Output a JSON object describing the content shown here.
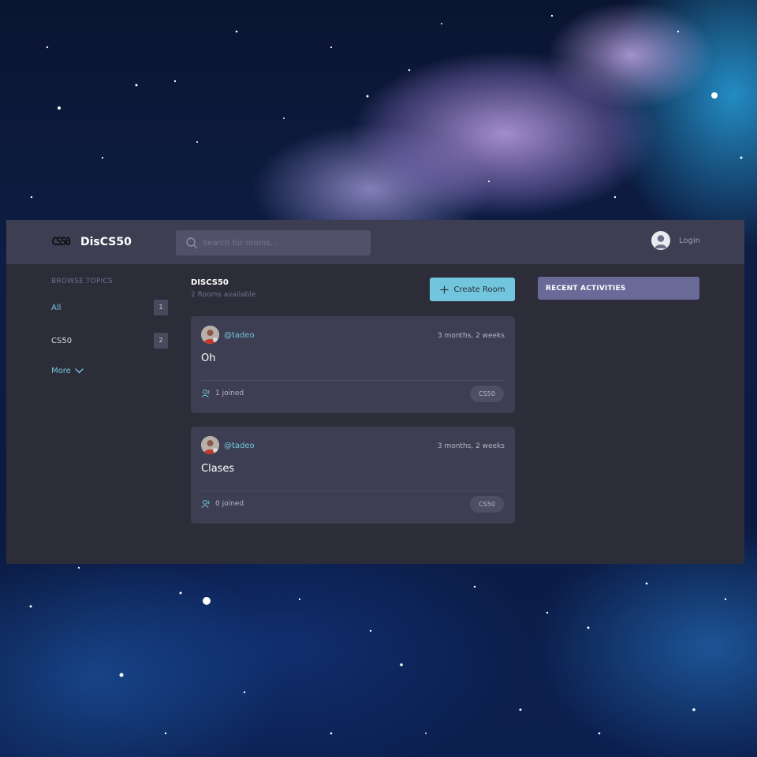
{
  "app": {
    "brand": {
      "logo_text": "CS50",
      "name": "DisCS50"
    },
    "search": {
      "placeholder": "Search for rooms..."
    },
    "user": {
      "login_label": "Login"
    }
  },
  "sidebar": {
    "title": "BROWSE TOPICS",
    "topics": [
      {
        "label": "All",
        "count": "1",
        "active": true
      },
      {
        "label": "CS50",
        "count": "2",
        "active": false
      }
    ],
    "more_label": "More"
  },
  "feed": {
    "title": "DISCS50",
    "subtitle": "2 Rooms available",
    "create_label": "Create Room",
    "rooms": [
      {
        "host": "@tadeo",
        "time": "3 months, 2 weeks",
        "title": "Oh",
        "joined": "1 joined",
        "topic": "CS50"
      },
      {
        "host": "@tadeo",
        "time": "3 months, 2 weeks",
        "title": "Clases",
        "joined": "0 joined",
        "topic": "CS50"
      }
    ]
  },
  "activities": {
    "title": "RECENT ACTIVITIES"
  },
  "colors": {
    "accent": "#71c6dd",
    "topbar": "#3e3e52",
    "panel": "#2d2d39",
    "card": "#3e3e52",
    "activities_header": "#696a98",
    "muted": "#6f6f8f"
  }
}
